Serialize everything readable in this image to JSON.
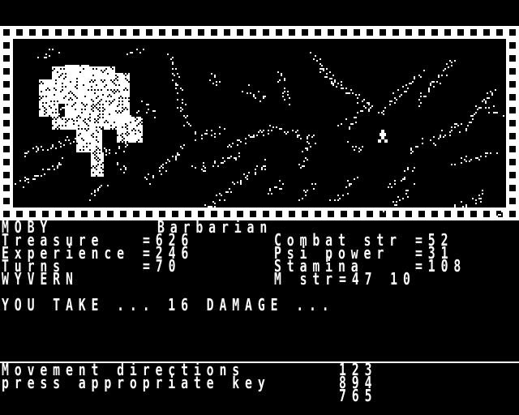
{
  "map": {
    "frame_color": "#ffffff",
    "terrain_color": "#ffffff",
    "player_icon": "player-figure-icon",
    "terrain_types": [
      "rough-ground",
      "building-ruin"
    ]
  },
  "character": {
    "name": "MOBY",
    "class": "Barbarian"
  },
  "stats": {
    "treasure_label": "Treasure",
    "treasure": "=626",
    "experience_label": "Experience",
    "experience": "=246",
    "turns_label": "Turns",
    "turns": "=70",
    "combat_label": "Combat str",
    "combat": "=52",
    "psi_label": "Psi power",
    "psi": "=31",
    "stamina_label": "Stamina",
    "stamina": "=108"
  },
  "monster": {
    "name": "WYVERN",
    "strength_label": "M str",
    "strength": "=47 10"
  },
  "message": "YOU TAKE ... 16 DAMAGE ...",
  "footer": {
    "line1": "Movement directions",
    "line2": "press appropriate key",
    "keypad": [
      "123",
      "894",
      "765"
    ]
  }
}
